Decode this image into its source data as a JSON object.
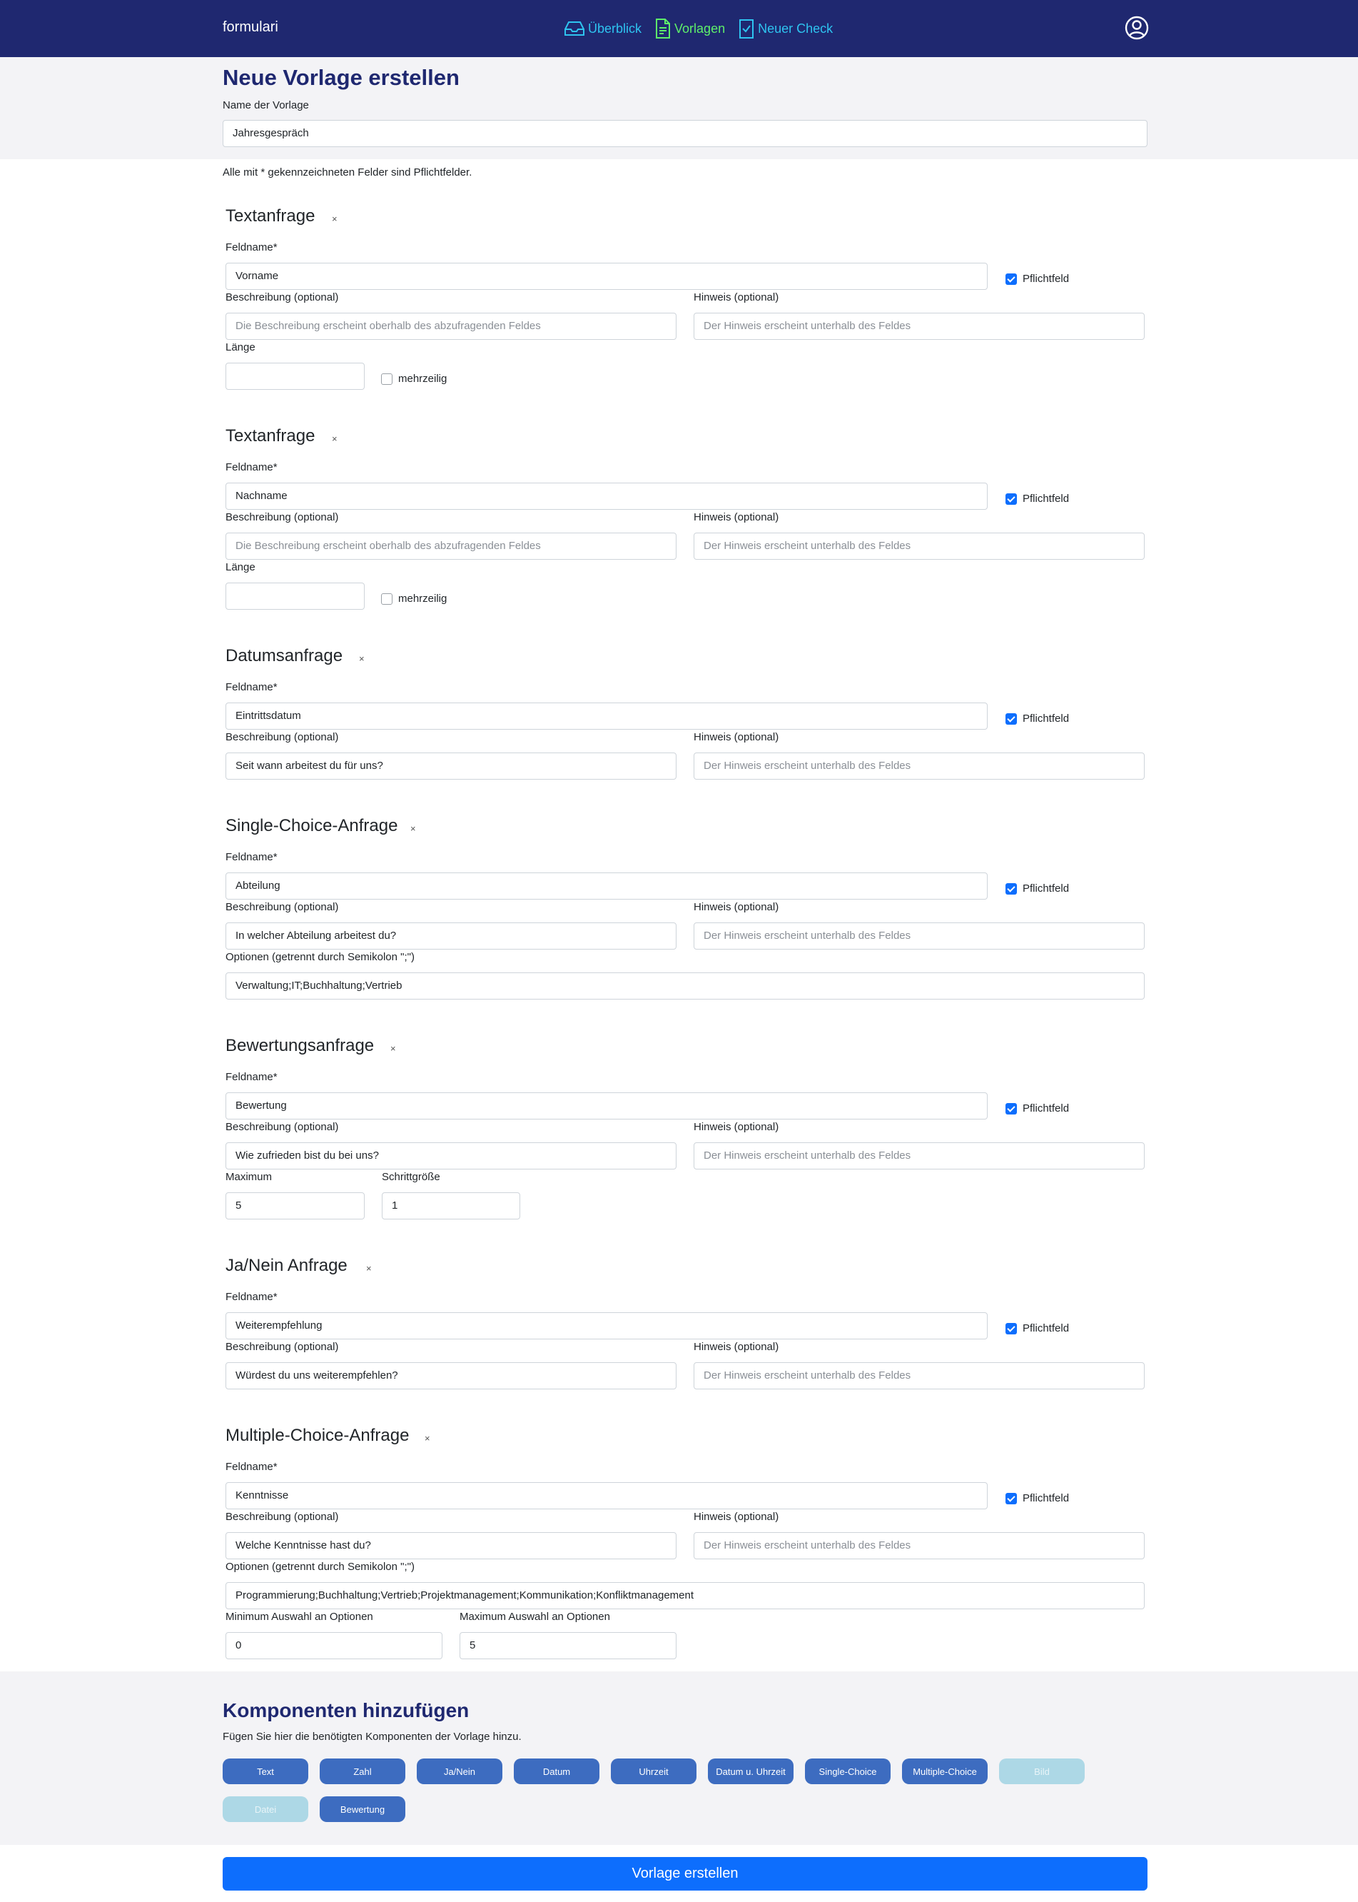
{
  "nav": {
    "brand": "formulari",
    "links": [
      "Überblick",
      "Vorlagen",
      "Neuer Check"
    ]
  },
  "page": {
    "title": "Neue Vorlage erstellen",
    "name_label": "Name der Vorlage",
    "name_value": "Jahresgespräch",
    "required_note": "Alle mit * gekennzeichneten Felder sind Pflichtfelder."
  },
  "common": {
    "feldname_label": "Feldname*",
    "beschreibung_label": "Beschreibung (optional)",
    "hinweis_label": "Hinweis (optional)",
    "beschreibung_placeholder": "Die Beschreibung erscheint oberhalb des abzufragenden Feldes",
    "hinweis_placeholder": "Der Hinweis erscheint unterhalb des Feldes",
    "pflichtfeld_label": "Pflichtfeld",
    "close": "×",
    "laenge_label": "Länge",
    "mehrzeilig_label": "mehrzeilig",
    "optionen_label": "Optionen (getrennt durch Semikolon \";\")",
    "maximum_label": "Maximum",
    "schrittgroesse_label": "Schrittgröße",
    "min_auswahl_label": "Minimum Auswahl an Optionen",
    "max_auswahl_label": "Maximum Auswahl an Optionen"
  },
  "sections": [
    {
      "title": "Textanfrage",
      "feldname": "Vorname",
      "beschreibung": "",
      "pflicht": true,
      "laenge": "",
      "mehrzeilig": false
    },
    {
      "title": "Textanfrage",
      "feldname": "Nachname",
      "beschreibung": "",
      "pflicht": true,
      "laenge": "",
      "mehrzeilig": false
    },
    {
      "title": "Datumsanfrage",
      "feldname": "Eintrittsdatum",
      "beschreibung": "Seit wann arbeitest du für uns?",
      "pflicht": true
    },
    {
      "title": "Single-Choice-Anfrage",
      "feldname": "Abteilung",
      "beschreibung": "In welcher Abteilung arbeitest du?",
      "pflicht": true,
      "optionen": "Verwaltung;IT;Buchhaltung;Vertrieb"
    },
    {
      "title": "Bewertungsanfrage",
      "feldname": "Bewertung",
      "beschreibung": "Wie zufrieden bist du bei uns?",
      "pflicht": true,
      "maximum": "5",
      "schrittgroesse": "1"
    },
    {
      "title": "Ja/Nein Anfrage",
      "feldname": "Weiterempfehlung",
      "beschreibung": "Würdest du uns weiterempfehlen?",
      "pflicht": true
    },
    {
      "title": "Multiple-Choice-Anfrage",
      "feldname": "Kenntnisse",
      "beschreibung": "Welche Kenntnisse hast du?",
      "pflicht": true,
      "optionen": "Programmierung;Buchhaltung;Vertrieb;Projektmanagement;Kommunikation;Konfliktmanagement",
      "min_auswahl": "0",
      "max_auswahl": "5"
    }
  ],
  "components": {
    "title": "Komponenten hinzufügen",
    "subtitle": "Fügen Sie hier die benötigten Komponenten der Vorlage hinzu.",
    "buttons": [
      "Text",
      "Zahl",
      "Ja/Nein",
      "Datum",
      "Uhrzeit",
      "Datum u. Uhrzeit",
      "Single-Choice",
      "Multiple-Choice",
      "Bild",
      "Datei",
      "Bewertung"
    ]
  },
  "submit_label": "Vorlage erstellen",
  "colors": {
    "navbar": "#1f2870",
    "primary": "#0d6efd",
    "pill": "#3d6cc0",
    "pill_disabled": "#add8e6",
    "nav_cyan": "#2ec4f0",
    "nav_green": "#5ef06a"
  }
}
